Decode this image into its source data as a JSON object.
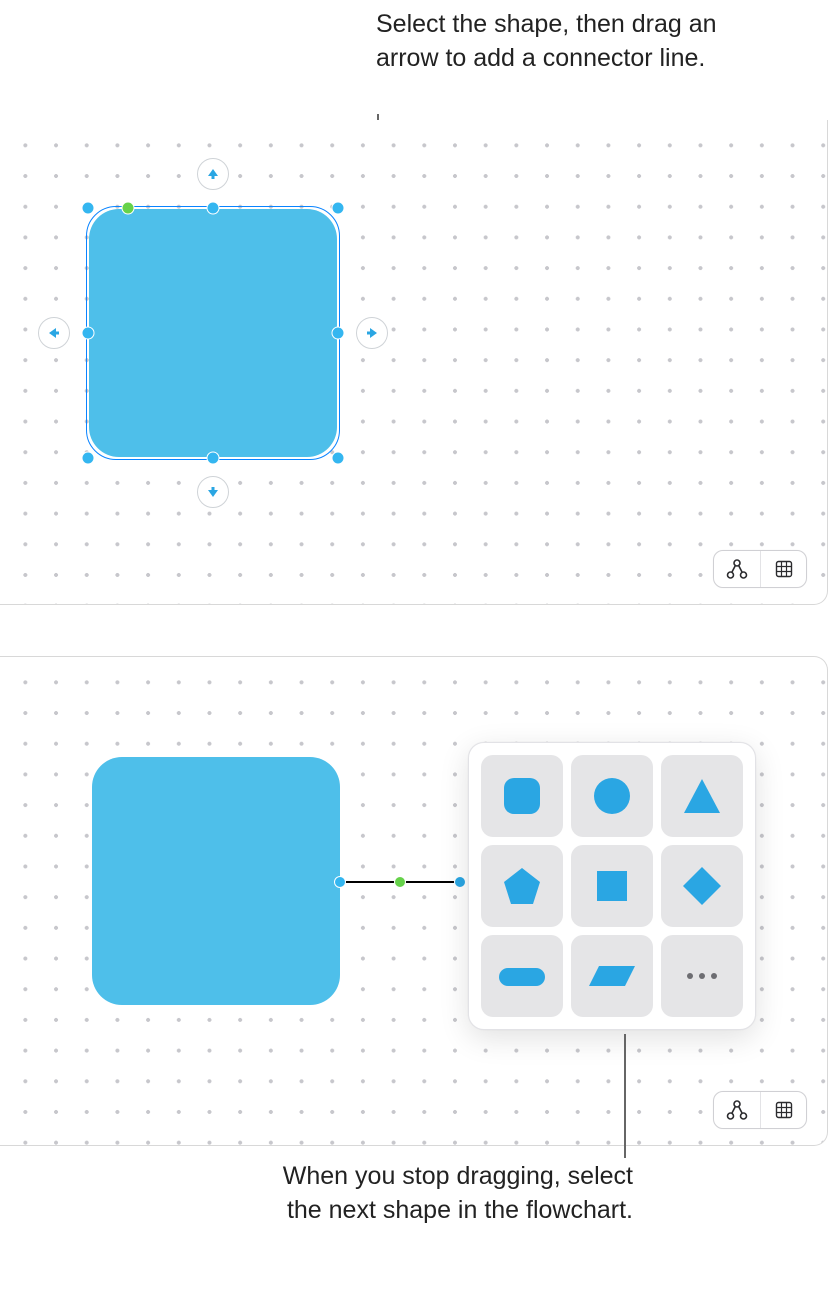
{
  "callouts": {
    "top": "Select the shape, then drag an arrow to add a connector line.",
    "bottom": "When you stop dragging, select the next shape in the flowchart."
  },
  "colors": {
    "shape_fill": "#4ebfea",
    "selection_blue": "#0a84ff",
    "handle_blue": "#34b6f0",
    "handle_green": "#66d24a",
    "picker_cell": "#e5e5e7"
  },
  "toolbar": {
    "diagram_icon": "diagram",
    "grid_icon": "grid"
  },
  "shape_picker": {
    "options": [
      "rounded-square",
      "circle",
      "triangle",
      "pentagon",
      "square",
      "diamond",
      "capsule",
      "parallelogram",
      "more"
    ]
  }
}
